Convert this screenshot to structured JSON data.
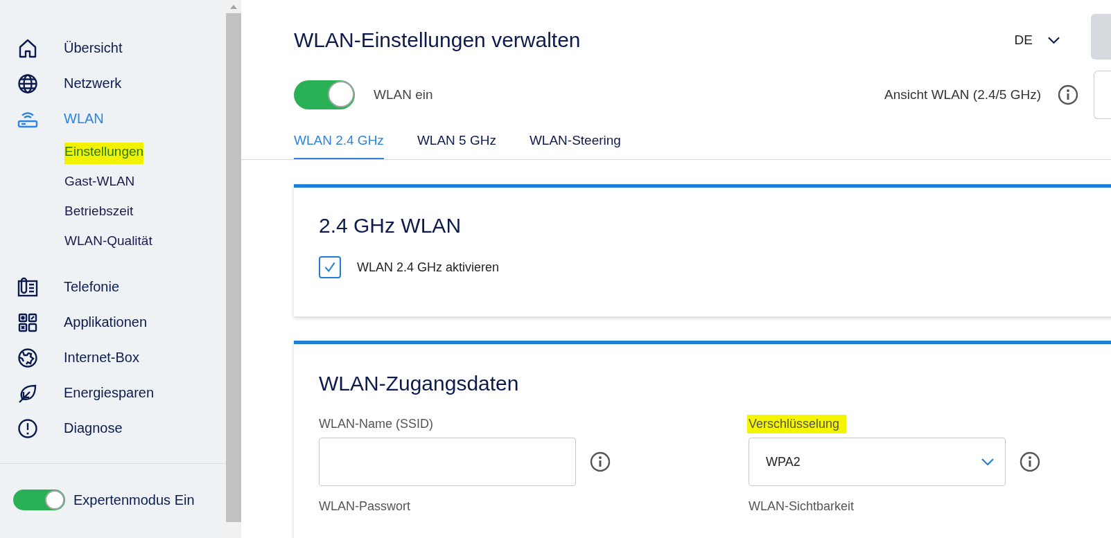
{
  "sidebar": {
    "items": [
      {
        "label": "Übersicht",
        "selected": false
      },
      {
        "label": "Netzwerk",
        "selected": false
      },
      {
        "label": "WLAN",
        "selected": true,
        "children": [
          {
            "label": "Einstellungen",
            "selected": true,
            "highlighted": true
          },
          {
            "label": "Gast-WLAN",
            "selected": false,
            "highlighted": false
          },
          {
            "label": "Betriebszeit",
            "selected": false,
            "highlighted": false
          },
          {
            "label": "WLAN-Qualität",
            "selected": false,
            "highlighted": false
          }
        ]
      },
      {
        "label": "Telefonie",
        "selected": false
      },
      {
        "label": "Applikationen",
        "selected": false
      },
      {
        "label": "Internet-Box",
        "selected": false
      },
      {
        "label": "Energiesparen",
        "selected": false
      },
      {
        "label": "Diagnose",
        "selected": false
      }
    ],
    "expert_mode": {
      "label": "Expertenmodus Ein",
      "on": true
    }
  },
  "header": {
    "title": "WLAN-Einstellungen verwalten",
    "language": "DE",
    "wlan_toggle": {
      "label": "WLAN ein",
      "on": true
    },
    "view_label": "Ansicht WLAN (2.4/5 GHz)"
  },
  "tabs": [
    {
      "label": "WLAN 2.4 GHz",
      "selected": true
    },
    {
      "label": "WLAN 5 GHz",
      "selected": false
    },
    {
      "label": "WLAN-Steering",
      "selected": false
    }
  ],
  "band_card": {
    "title": "2.4 GHz WLAN",
    "checkbox": {
      "label": "WLAN 2.4 GHz aktivieren",
      "checked": true
    }
  },
  "access_card": {
    "title": "WLAN-Zugangsdaten",
    "fields": [
      {
        "kind": "text",
        "label": "WLAN-Name (SSID)",
        "highlighted": false
      },
      {
        "kind": "select",
        "label": "Verschlüsselung",
        "value": "WPA2",
        "highlighted": true
      },
      {
        "kind": "label",
        "label": "WLAN-Passwort",
        "highlighted": false
      },
      {
        "kind": "label",
        "label": "WLAN-Sichtbarkeit",
        "highlighted": false
      }
    ]
  }
}
